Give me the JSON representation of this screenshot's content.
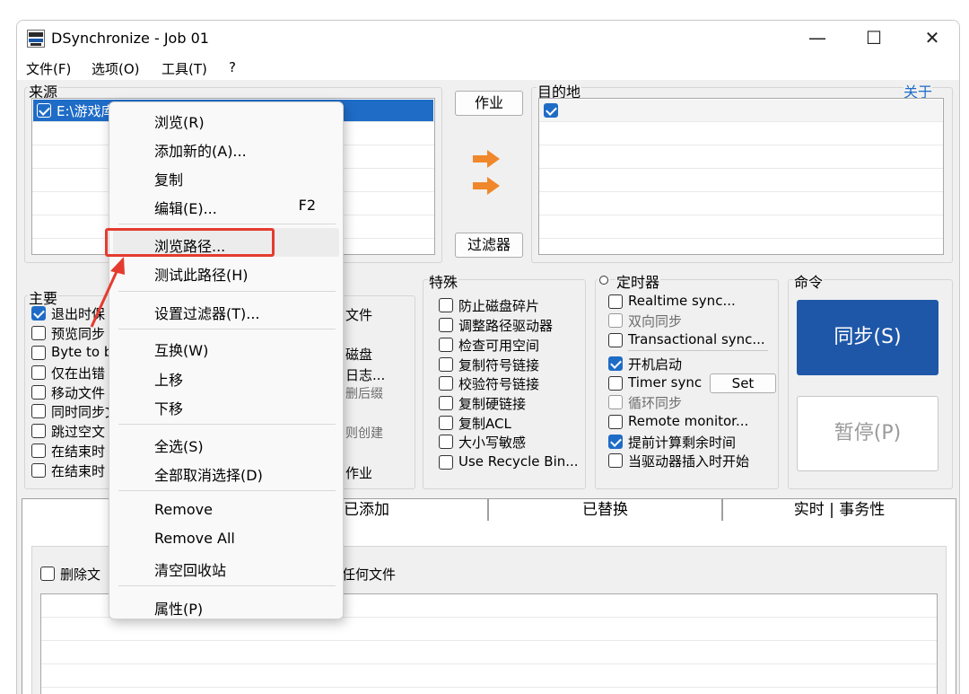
{
  "window": {
    "title": "DSynchronize - Job 01",
    "min_glyph": "—",
    "max_glyph": "☐",
    "close_glyph": "✕"
  },
  "menu": {
    "file": "文件(F)",
    "options": "选项(O)",
    "tools": "工具(T)",
    "help": "?"
  },
  "source": {
    "label": "来源",
    "item_path": "E:\\游戏库"
  },
  "dest": {
    "label": "目的地",
    "about": "关于"
  },
  "buttons": {
    "job": "作业",
    "filter": "过滤器",
    "sync": "同步(S)",
    "pause": "暂停(P)",
    "set": "Set"
  },
  "main_options": {
    "label": "主要",
    "items": [
      {
        "text": "退出时保",
        "checked": true
      },
      {
        "text": "预览同步",
        "checked": false
      },
      {
        "text": "Byte to b",
        "checked": false
      },
      {
        "text": "仅在出错",
        "checked": false
      },
      {
        "text": "移动文件",
        "checked": false
      },
      {
        "text": "同时同步文",
        "checked": false
      },
      {
        "text": "跳过空文",
        "checked": false
      },
      {
        "text": "在结束时",
        "checked": false
      },
      {
        "text": "在结束时",
        "checked": false
      }
    ],
    "partial": [
      "文件",
      "磁盘",
      "日志...",
      "删后缀",
      "则创建",
      "作业"
    ]
  },
  "special": {
    "label": "特殊",
    "items": [
      {
        "text": "防止磁盘碎片",
        "checked": false
      },
      {
        "text": "调整路径驱动器",
        "checked": false
      },
      {
        "text": "检查可用空间",
        "checked": false
      },
      {
        "text": "复制符号链接",
        "checked": false
      },
      {
        "text": "校验符号链接",
        "checked": false
      },
      {
        "text": "复制硬链接",
        "checked": false
      },
      {
        "text": "复制ACL",
        "checked": false
      },
      {
        "text": "大小写敏感",
        "checked": false
      },
      {
        "text": "Use Recycle Bin...",
        "checked": false
      }
    ]
  },
  "timer": {
    "label": "定时器",
    "items": [
      {
        "text": "Realtime sync...",
        "checked": false
      },
      {
        "text": "双向同步",
        "checked": false
      },
      {
        "text": "Transactional sync...",
        "checked": false
      },
      {
        "text": "开机启动",
        "checked": true
      },
      {
        "text": "Timer sync",
        "checked": false
      },
      {
        "text": "循环同步",
        "checked": false
      },
      {
        "text": "Remote monitor...",
        "checked": false
      },
      {
        "text": "提前计算剩余时间",
        "checked": true
      },
      {
        "text": "当驱动器插入时开始",
        "checked": false
      }
    ]
  },
  "command": {
    "label": "命令"
  },
  "tabs": {
    "added": "已添加",
    "replaced": "已替换",
    "realtime": "实时 | 事务性"
  },
  "bottom": {
    "delete_label": "删除文",
    "partial": "任何文件"
  },
  "context_menu": {
    "browse": "浏览(R)",
    "add_new": "添加新的(A)...",
    "copy": "复制",
    "edit": "编辑(E)...",
    "edit_shortcut": "F2",
    "browse_path": "浏览路径...",
    "test_path": "测试此路径(H)",
    "set_filter": "设置过滤器(T)...",
    "swap": "互换(W)",
    "move_up": "上移",
    "move_down": "下移",
    "select_all": "全选(S)",
    "deselect_all": "全部取消选择(D)",
    "remove": "Remove",
    "remove_all": "Remove All",
    "empty_bin": "清空回收站",
    "properties": "属性(P)"
  },
  "colors": {
    "accent": "#1f57a8",
    "selection": "#1f6cc7",
    "highlight": "#e53b2f",
    "arrow": "#f0872a"
  }
}
